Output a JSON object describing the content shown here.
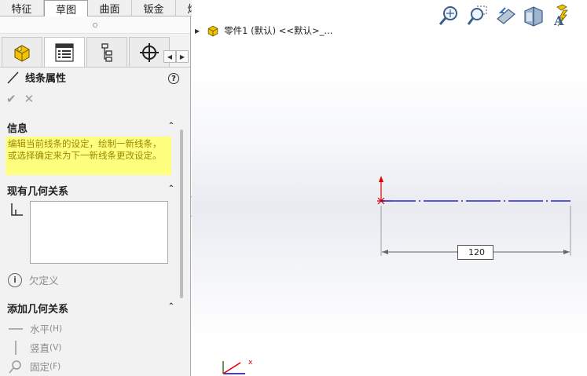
{
  "command_tabs": [
    "特征",
    "草图",
    "曲面",
    "钣金",
    "焊件"
  ],
  "active_command_tab": "草图",
  "feature_manager_tabs": [
    {
      "name": "feature-manager-tab",
      "icon": "part-icon"
    },
    {
      "name": "property-manager-tab",
      "icon": "property-list-icon"
    },
    {
      "name": "configuration-manager-tab",
      "icon": "config-tree-icon"
    },
    {
      "name": "dimxpert-manager-tab",
      "icon": "crosshair-icon"
    }
  ],
  "property_manager": {
    "title": "线条属性",
    "help_label": "?"
  },
  "info_section": {
    "title": "信息",
    "message": "编辑当前线条的设定，绘制一新线条，或选择确定来为下一新线条更改设定。"
  },
  "existing_relations": {
    "title": "现有几何关系",
    "status": "欠定义"
  },
  "add_relations": {
    "title": "添加几何关系",
    "items": [
      {
        "label": "水平",
        "shortcut": "(H)",
        "icon": "horizontal-icon"
      },
      {
        "label": "竖直",
        "shortcut": "(V)",
        "icon": "vertical-icon"
      },
      {
        "label": "固定",
        "shortcut": "(F)",
        "icon": "fix-icon"
      }
    ]
  },
  "tree": {
    "part_label": "零件1 (默认) <<默认>_..."
  },
  "dimension": {
    "value": "120"
  },
  "triad": {
    "x_label": "x"
  },
  "colors": {
    "sketch_line": "#0000cc",
    "origin": "#e00000",
    "info_bg": "#ffff7f",
    "info_text": "#9a8a00"
  }
}
